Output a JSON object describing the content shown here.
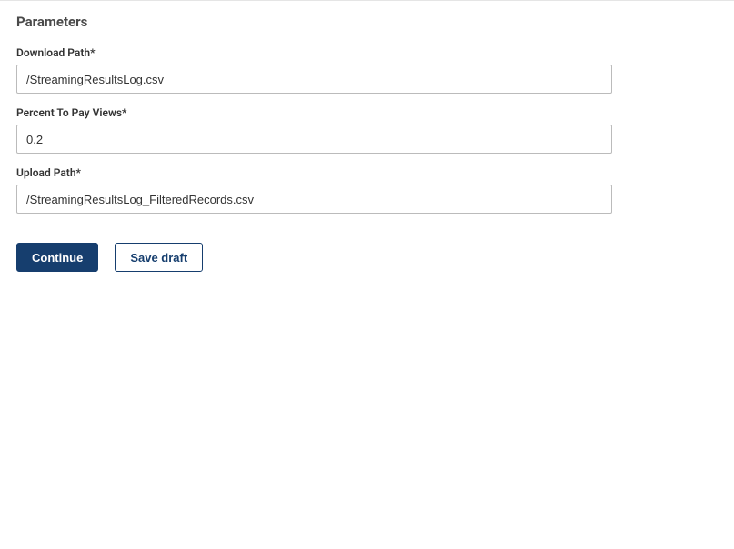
{
  "section": {
    "title": "Parameters"
  },
  "fields": {
    "download_path": {
      "label": "Download Path*",
      "value": "/StreamingResultsLog.csv"
    },
    "percent_to_pay_views": {
      "label": "Percent To Pay Views*",
      "value": "0.2"
    },
    "upload_path": {
      "label": "Upload Path*",
      "value": "/StreamingResultsLog_FilteredRecords.csv"
    }
  },
  "buttons": {
    "continue": "Continue",
    "save_draft": "Save draft"
  }
}
